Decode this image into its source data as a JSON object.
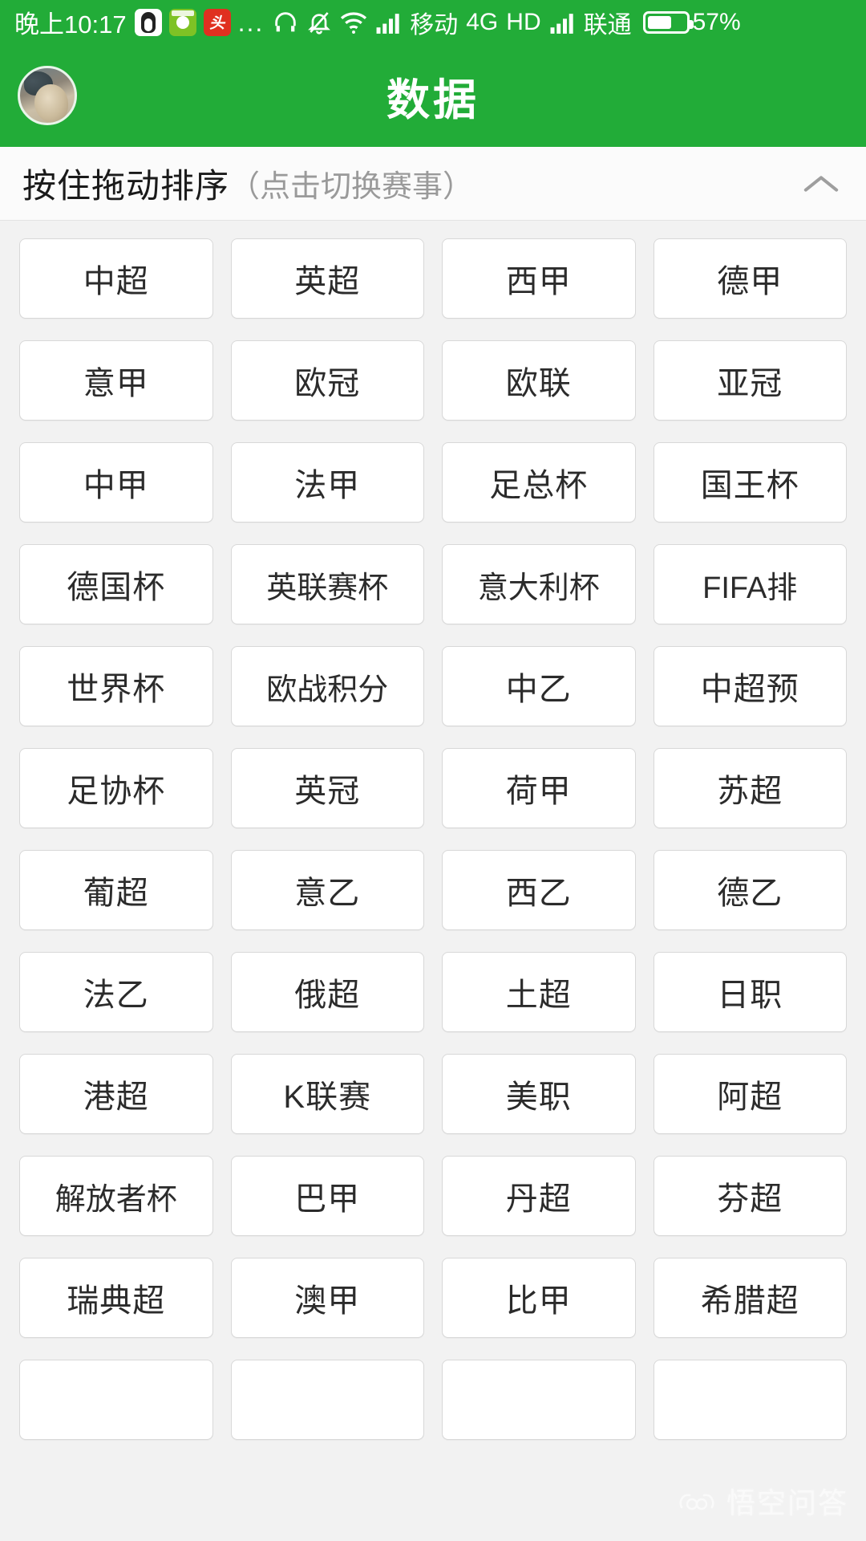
{
  "status_bar": {
    "time": "晚上10:17",
    "app_icons": [
      "qq-icon",
      "green-app-icon",
      "toutiao-icon"
    ],
    "overflow": "...",
    "icons": [
      "headphone-icon",
      "mute-bell-icon",
      "wifi-icon",
      "signal-icon-1",
      "signal-icon-2"
    ],
    "carrier_1": "移动",
    "network": "4G",
    "hd": "HD",
    "carrier_2": "联通",
    "battery_percent": "57%",
    "background_color": "#22ac38",
    "text_color": "#ffffff"
  },
  "app_bar": {
    "title": "数据",
    "avatar": "user-avatar",
    "background_color": "#22ac38"
  },
  "section_header": {
    "title": "按住拖动排序",
    "subtitle": "（点击切换赛事）",
    "collapse_icon": "chevron-up-icon"
  },
  "league_grid": {
    "columns": 4,
    "items": [
      "中超",
      "英超",
      "西甲",
      "德甲",
      "意甲",
      "欧冠",
      "欧联",
      "亚冠",
      "中甲",
      "法甲",
      "足总杯",
      "国王杯",
      "德国杯",
      "英联赛杯",
      "意大利杯",
      "FIFA排",
      "世界杯",
      "欧战积分",
      "中乙",
      "中超预",
      "足协杯",
      "英冠",
      "荷甲",
      "苏超",
      "葡超",
      "意乙",
      "西乙",
      "德乙",
      "法乙",
      "俄超",
      "土超",
      "日职",
      "港超",
      "K联赛",
      "美职",
      "阿超",
      "解放者杯",
      "巴甲",
      "丹超",
      "芬超",
      "瑞典超",
      "澳甲",
      "比甲",
      "希腊超",
      "",
      "",
      "",
      ""
    ]
  },
  "watermark": {
    "text": "悟空问答",
    "logo": "wukong-face-logo"
  }
}
